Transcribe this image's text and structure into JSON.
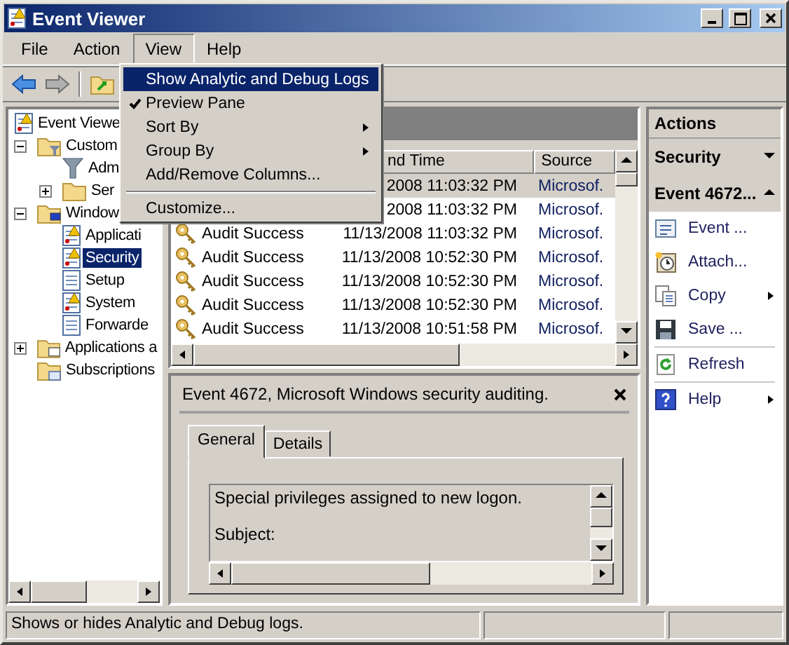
{
  "window": {
    "title": "Event Viewer"
  },
  "menu_bar": [
    {
      "label": "File",
      "selected": false
    },
    {
      "label": "Action",
      "selected": false
    },
    {
      "label": "View",
      "selected": true
    },
    {
      "label": "Help",
      "selected": false
    }
  ],
  "view_menu": [
    {
      "kind": "item",
      "label": "Show Analytic and Debug Logs",
      "selected": true,
      "checked": false,
      "submenu": false
    },
    {
      "kind": "item",
      "label": "Preview Pane",
      "selected": false,
      "checked": true,
      "submenu": false
    },
    {
      "kind": "item",
      "label": "Sort By",
      "selected": false,
      "checked": false,
      "submenu": true
    },
    {
      "kind": "item",
      "label": "Group By",
      "selected": false,
      "checked": false,
      "submenu": true
    },
    {
      "kind": "item",
      "label": "Add/Remove Columns...",
      "selected": false,
      "checked": false,
      "submenu": false
    },
    {
      "kind": "separator"
    },
    {
      "kind": "item",
      "label": "Customize...",
      "selected": false,
      "checked": false,
      "submenu": false
    }
  ],
  "tree": [
    {
      "label": "Event Viewe",
      "kind": "log-warning",
      "selected": false,
      "children": [
        {
          "label": "Custom",
          "kind": "filter-folder",
          "selected": false,
          "expanded": true,
          "children": [
            {
              "label": "Adm",
              "kind": "filter",
              "selected": false
            },
            {
              "label": "Ser",
              "kind": "folder",
              "selected": false,
              "expanded": false
            }
          ]
        },
        {
          "label": "Window",
          "kind": "computer-folder",
          "selected": false,
          "expanded": true,
          "children": [
            {
              "label": "Applicati",
              "kind": "log-warning",
              "selected": false
            },
            {
              "label": "Security",
              "kind": "log-warning",
              "selected": true
            },
            {
              "label": "Setup",
              "kind": "log",
              "selected": false
            },
            {
              "label": "System",
              "kind": "log-warning",
              "selected": false
            },
            {
              "label": "Forwarde",
              "kind": "log",
              "selected": false
            }
          ]
        },
        {
          "label": "Applications a",
          "kind": "window-folder",
          "selected": false,
          "expanded": false
        },
        {
          "label": "Subscriptions",
          "kind": "subscription-folder",
          "selected": false
        }
      ]
    }
  ],
  "events": {
    "columns": [
      "nd Time",
      "Source"
    ],
    "rows": [
      {
        "date": "2008 11:03:32 PM",
        "source": "Microsof.",
        "selected": true
      },
      {
        "date": "2008 11:03:32 PM",
        "source": "Microsof.",
        "selected": false
      },
      {
        "level": "Audit Success",
        "date": "11/13/2008 11:03:32 PM",
        "source": "Microsof.",
        "selected": false
      },
      {
        "level": "Audit Success",
        "date": "11/13/2008 10:52:30 PM",
        "source": "Microsof.",
        "selected": false
      },
      {
        "level": "Audit Success",
        "date": "11/13/2008 10:52:30 PM",
        "source": "Microsof.",
        "selected": false
      },
      {
        "level": "Audit Success",
        "date": "11/13/2008 10:52:30 PM",
        "source": "Microsof.",
        "selected": false
      },
      {
        "level": "Audit Success",
        "date": "11/13/2008 10:51:58 PM",
        "source": "Microsof.",
        "selected": false
      }
    ]
  },
  "preview": {
    "title": "Event 4672, Microsoft Windows security auditing.",
    "tabs": [
      {
        "label": "General",
        "selected": true
      },
      {
        "label": "Details",
        "selected": false
      }
    ],
    "lines": [
      "Special privileges assigned to new logon.",
      "Subject:"
    ]
  },
  "actions": {
    "title": "Actions",
    "sections": [
      {
        "label": "Security",
        "expanded": false
      },
      {
        "label": "Event 4672...",
        "expanded": true
      }
    ],
    "items": [
      {
        "kind": "item",
        "label": "Event ...",
        "submenu": false
      },
      {
        "kind": "item",
        "label": "Attach...",
        "submenu": false
      },
      {
        "kind": "item",
        "label": "Copy",
        "submenu": true
      },
      {
        "kind": "item",
        "label": "Save ...",
        "submenu": false
      },
      {
        "kind": "separator"
      },
      {
        "kind": "item",
        "label": "Refresh",
        "submenu": false
      },
      {
        "kind": "separator"
      },
      {
        "kind": "item",
        "label": "Help",
        "submenu": true
      }
    ]
  },
  "status_bar": [
    "Shows or hides Analytic and Debug logs."
  ]
}
